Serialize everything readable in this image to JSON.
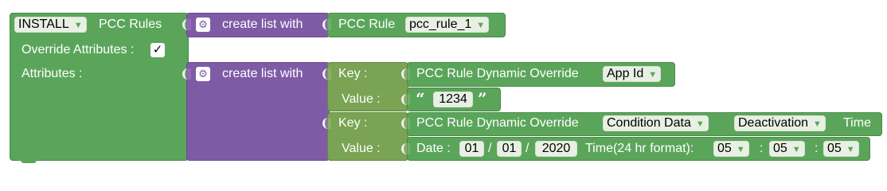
{
  "install_block": {
    "action": "INSTALL",
    "title": "PCC Rules",
    "override_label": "Override Attributes :",
    "override_checked": true,
    "override_check_glyph": "✓",
    "attributes_label": "Attributes :"
  },
  "rules_list": {
    "label": "create list with"
  },
  "pcc_rule": {
    "label": "PCC Rule",
    "selected": "pcc_rule_1"
  },
  "attributes_list": {
    "label": "create list with"
  },
  "pairs": [
    {
      "key_label": "Key :",
      "value_label": "Value :",
      "key_block": {
        "label": "PCC Rule Dynamic Override",
        "selected": "App Id"
      },
      "value_block": {
        "open_quote": "“",
        "text": "1234",
        "close_quote": "”"
      }
    },
    {
      "key_label": "Key :",
      "value_label": "Value :",
      "key_block": {
        "label": "PCC Rule Dynamic Override",
        "selected": "Condition Data",
        "selected_2": "Deactivation",
        "suffix": "Time"
      },
      "value_block": {
        "date_label": "Date :",
        "day": "01",
        "month": "01",
        "year": "2020",
        "sep": "/",
        "time_label": "Time(24 hr format):",
        "hour": "05",
        "minute": "05",
        "second": "05",
        "time_sep": ":"
      }
    }
  ],
  "icons": {
    "gear": "gear-icon",
    "dropdown": "dropdown-arrow-icon"
  },
  "colors": {
    "install_green": "#5ba55b",
    "list_purple": "#7f5ba6",
    "pair_olive": "#7aa353",
    "field_bg": "#e8f0e4"
  }
}
